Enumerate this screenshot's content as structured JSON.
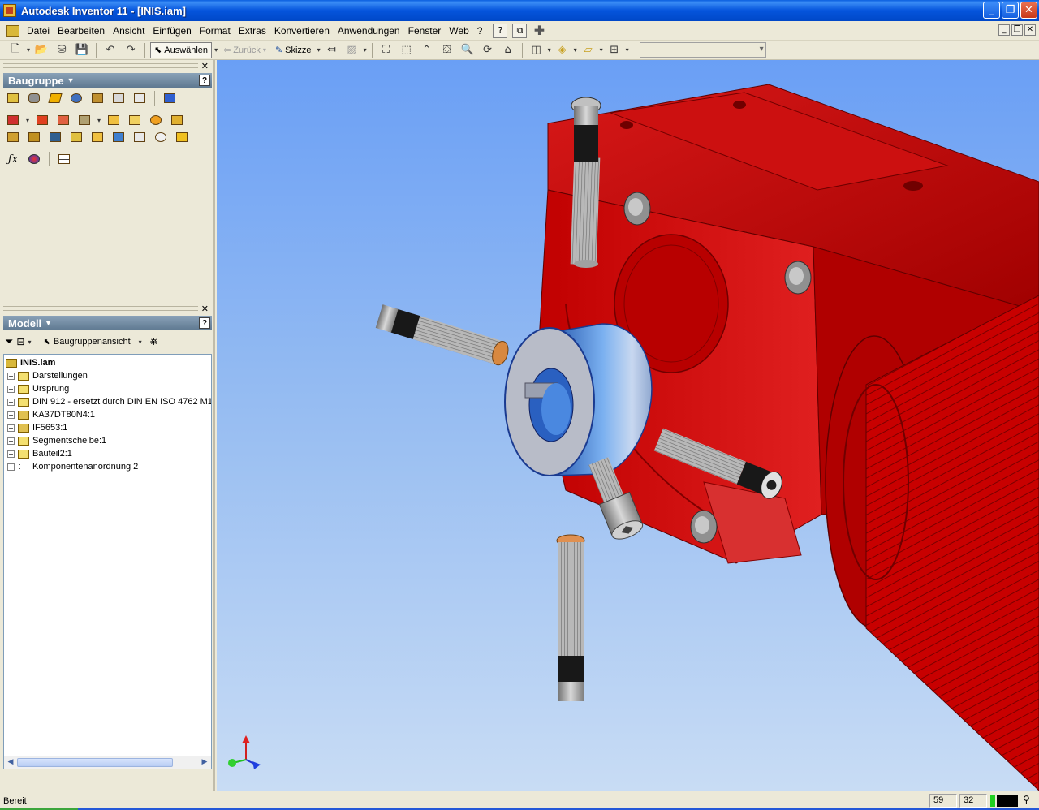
{
  "window": {
    "title": "Autodesk Inventor 11 - [INIS.iam]",
    "minimize": "_",
    "restore": "❐",
    "close": "✕"
  },
  "menu": {
    "items": [
      "Datei",
      "Bearbeiten",
      "Ansicht",
      "Einfügen",
      "Format",
      "Extras",
      "Konvertieren",
      "Anwendungen",
      "Fenster",
      "Web",
      "?"
    ]
  },
  "toolbar": {
    "select_label": "Auswählen",
    "back_label": "Zurück",
    "sketch_label": "Skizze",
    "combo_value": ""
  },
  "assembly_panel": {
    "title": "Baugruppe"
  },
  "model_panel": {
    "title": "Modell",
    "view_label": "Baugruppenansicht",
    "tree_root": "INIS.iam",
    "tree_items": [
      {
        "label": "Darstellungen",
        "icon": "folder-icon"
      },
      {
        "label": "Ursprung",
        "icon": "folder-icon"
      },
      {
        "label": "DIN 912  - ersetzt durch DIN EN ISO 4762 M1",
        "icon": "part-icon"
      },
      {
        "label": "KA37DT80N4:1",
        "icon": "assembly-icon"
      },
      {
        "label": "IF5653:1",
        "icon": "assembly-icon"
      },
      {
        "label": "Segmentscheibe:1",
        "icon": "part-icon"
      },
      {
        "label": "Bauteil2:1",
        "icon": "part-icon"
      },
      {
        "label": "Komponentenanordnung 2",
        "icon": "pattern-icon"
      }
    ]
  },
  "status": {
    "text": "Bereit",
    "value1": "59",
    "value2": "32"
  },
  "colors": {
    "gear_red": "#c00000",
    "hub_blue": "#3a78d0",
    "viewport_top": "#6a9ff5",
    "viewport_bottom": "#c8dcf4"
  }
}
